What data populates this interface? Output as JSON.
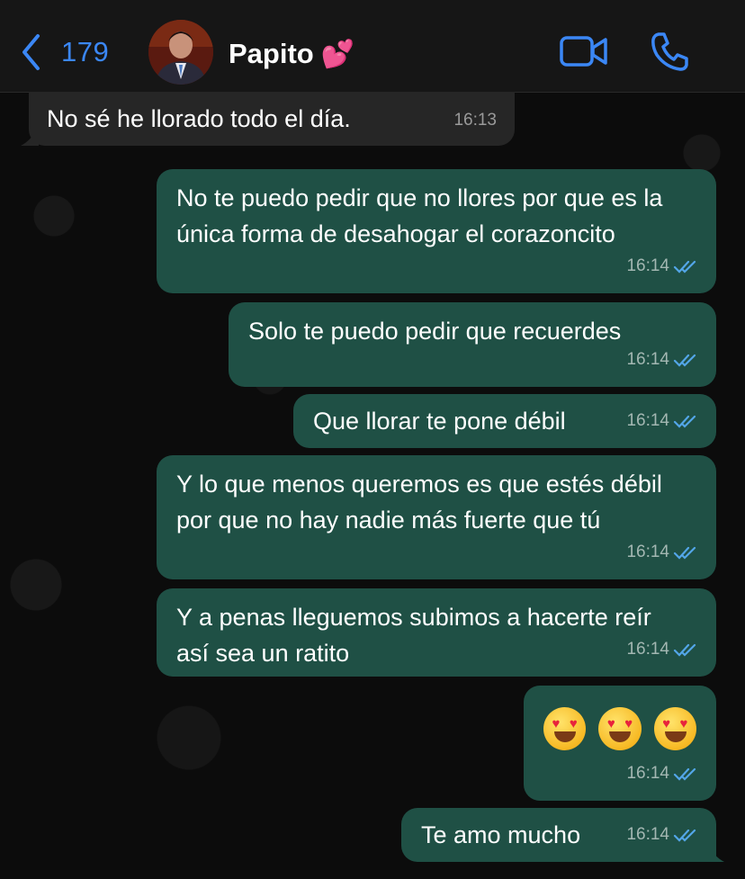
{
  "header": {
    "back_count": "179",
    "contact_name": "Papito",
    "contact_emoji": "💕",
    "icons": {
      "back": "chevron-left-icon",
      "video": "video-call-icon",
      "call": "phone-icon"
    },
    "accent_color": "#3b87f5"
  },
  "messages": [
    {
      "direction": "in",
      "text": "No sé he llorado todo el día.",
      "time": "16:13"
    },
    {
      "direction": "out",
      "text": "No te puedo pedir que no llores por que es la única forma de desahogar el corazoncito",
      "time": "16:14",
      "status": "read"
    },
    {
      "direction": "out",
      "text": "Solo te puedo pedir que recuerdes",
      "time": "16:14",
      "status": "read"
    },
    {
      "direction": "out",
      "text": "Que llorar te pone débil",
      "time": "16:14",
      "status": "read"
    },
    {
      "direction": "out",
      "text": "Y lo que menos queremos es que estés débil por que no hay nadie más fuerte que tú",
      "time": "16:14",
      "status": "read"
    },
    {
      "direction": "out",
      "text": "Y a penas lleguemos subimos a hacerte reír así sea un ratito",
      "time": "16:14",
      "status": "read"
    },
    {
      "direction": "out",
      "text": "😍 😍 😍",
      "time": "16:14",
      "status": "read"
    },
    {
      "direction": "out",
      "text": "Te amo mucho",
      "time": "16:14",
      "status": "read"
    }
  ],
  "colors": {
    "incoming_bubble": "#262626",
    "outgoing_bubble": "#1f5045",
    "read_ticks": "#53a6e8"
  }
}
